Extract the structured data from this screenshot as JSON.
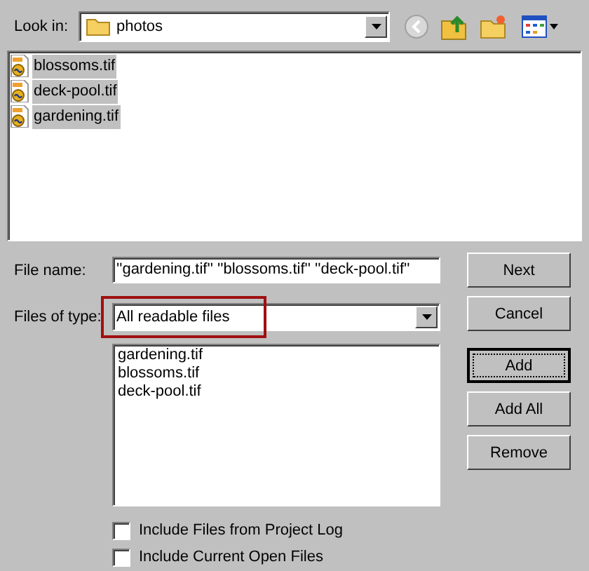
{
  "look_in": {
    "label": "Look in:",
    "value": "photos"
  },
  "files": [
    {
      "name": "blossoms.tif",
      "selected": true
    },
    {
      "name": "deck-pool.tif",
      "selected": true
    },
    {
      "name": "gardening.tif",
      "selected": true
    }
  ],
  "file_name": {
    "label": "File name:",
    "value": "''gardening.tif'' ''blossoms.tif'' ''deck-pool.tif''"
  },
  "files_of_type": {
    "label": "Files of type:",
    "value": "All readable files",
    "highlighted": true
  },
  "chosen_files": [
    "gardening.tif",
    "blossoms.tif",
    "deck-pool.tif"
  ],
  "buttons": [
    {
      "label": "Next",
      "focused": false
    },
    {
      "label": "Cancel",
      "focused": false
    },
    {
      "label": "Add",
      "focused": true
    },
    {
      "label": "Add All",
      "focused": false
    },
    {
      "label": "Remove",
      "focused": false
    }
  ],
  "options": [
    {
      "label": "Include Files from Project Log",
      "checked": false
    },
    {
      "label": "Include Current Open Files",
      "checked": false
    }
  ]
}
